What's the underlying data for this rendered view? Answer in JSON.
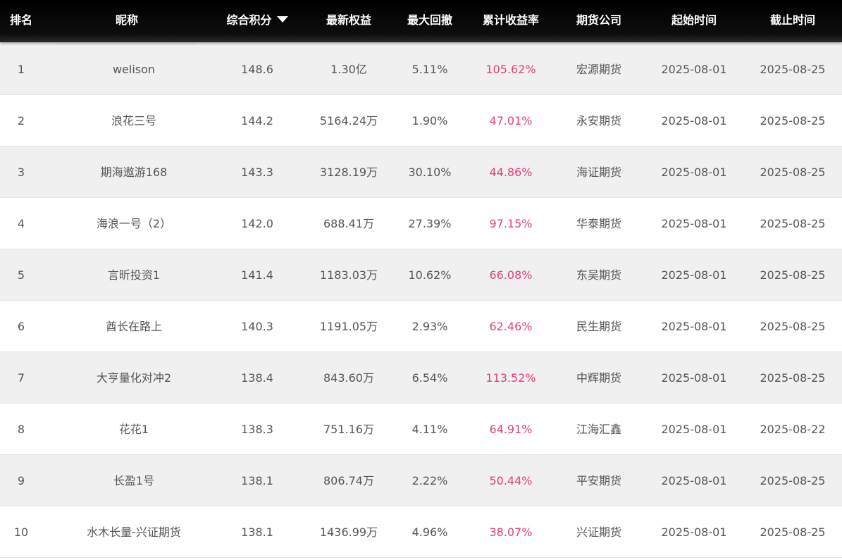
{
  "columns": [
    {
      "key": "rank",
      "label": "排名"
    },
    {
      "key": "name",
      "label": "昵称"
    },
    {
      "key": "score",
      "label": "综合积分",
      "sort": "desc"
    },
    {
      "key": "equity",
      "label": "最新权益"
    },
    {
      "key": "drawdown",
      "label": "最大回撤"
    },
    {
      "key": "return",
      "label": "累计收益率"
    },
    {
      "key": "broker",
      "label": "期货公司"
    },
    {
      "key": "start",
      "label": "起始时间"
    },
    {
      "key": "end",
      "label": "截止时间"
    }
  ],
  "accent_color": "#e0407f",
  "rows": [
    {
      "rank": "1",
      "name": "welison",
      "score": "148.6",
      "equity": "1.30亿",
      "drawdown": "5.11%",
      "return": "105.62%",
      "broker": "宏源期货",
      "start": "2025-08-01",
      "end": "2025-08-25"
    },
    {
      "rank": "2",
      "name": "浪花三号",
      "score": "144.2",
      "equity": "5164.24万",
      "drawdown": "1.90%",
      "return": "47.01%",
      "broker": "永安期货",
      "start": "2025-08-01",
      "end": "2025-08-25"
    },
    {
      "rank": "3",
      "name": "期海遨游168",
      "score": "143.3",
      "equity": "3128.19万",
      "drawdown": "30.10%",
      "return": "44.86%",
      "broker": "海证期货",
      "start": "2025-08-01",
      "end": "2025-08-25"
    },
    {
      "rank": "4",
      "name": "海浪一号（2）",
      "score": "142.0",
      "equity": "688.41万",
      "drawdown": "27.39%",
      "return": "97.15%",
      "broker": "华泰期货",
      "start": "2025-08-01",
      "end": "2025-08-25"
    },
    {
      "rank": "5",
      "name": "言昕投资1",
      "score": "141.4",
      "equity": "1183.03万",
      "drawdown": "10.62%",
      "return": "66.08%",
      "broker": "东吴期货",
      "start": "2025-08-01",
      "end": "2025-08-25"
    },
    {
      "rank": "6",
      "name": "酋长在路上",
      "score": "140.3",
      "equity": "1191.05万",
      "drawdown": "2.93%",
      "return": "62.46%",
      "broker": "民生期货",
      "start": "2025-08-01",
      "end": "2025-08-25"
    },
    {
      "rank": "7",
      "name": "大亨量化对冲2",
      "score": "138.4",
      "equity": "843.60万",
      "drawdown": "6.54%",
      "return": "113.52%",
      "broker": "中辉期货",
      "start": "2025-08-01",
      "end": "2025-08-25"
    },
    {
      "rank": "8",
      "name": "花花1",
      "score": "138.3",
      "equity": "751.16万",
      "drawdown": "4.11%",
      "return": "64.91%",
      "broker": "江海汇鑫",
      "start": "2025-08-01",
      "end": "2025-08-22"
    },
    {
      "rank": "9",
      "name": "长盈1号",
      "score": "138.1",
      "equity": "806.74万",
      "drawdown": "2.22%",
      "return": "50.44%",
      "broker": "平安期货",
      "start": "2025-08-01",
      "end": "2025-08-25"
    },
    {
      "rank": "10",
      "name": "水木长量-兴证期货",
      "score": "138.1",
      "equity": "1436.99万",
      "drawdown": "4.96%",
      "return": "38.07%",
      "broker": "兴证期货",
      "start": "2025-08-01",
      "end": "2025-08-25"
    }
  ]
}
